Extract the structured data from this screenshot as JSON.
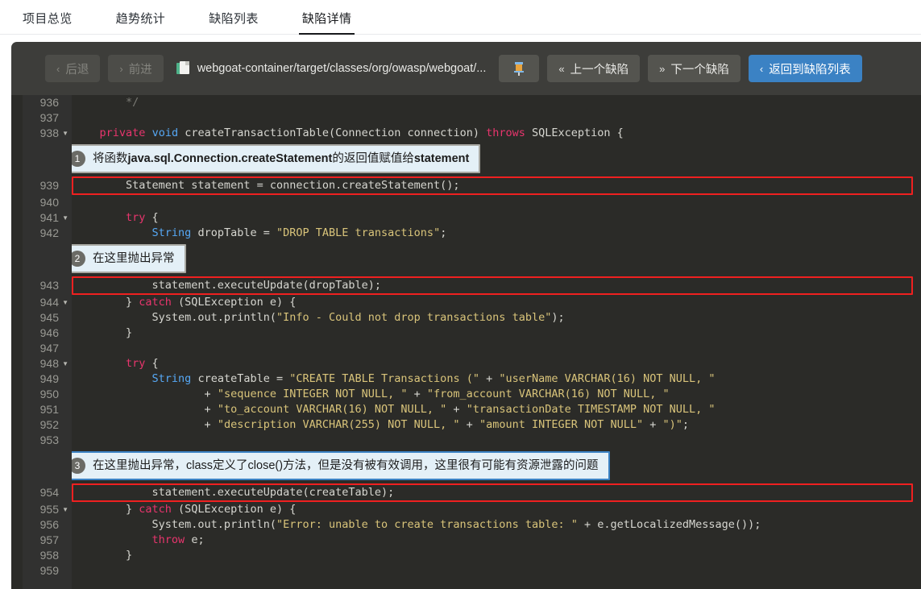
{
  "tabs": [
    {
      "label": "项目总览",
      "active": false
    },
    {
      "label": "趋势统计",
      "active": false
    },
    {
      "label": "缺陷列表",
      "active": false
    },
    {
      "label": "缺陷详情",
      "active": true
    }
  ],
  "toolbar": {
    "back_label": "后退",
    "forward_label": "前进",
    "file_path": "webgoat-container/target/classes/org/owasp/webgoat/...",
    "pin_icon": "pin-icon",
    "prev_defect_label": "上一个缺陷",
    "next_defect_label": "下一个缺陷",
    "back_to_list_label": "返回到缺陷列表",
    "prev_chevron": "«",
    "next_chevron": "»",
    "back_chevron": "‹",
    "forward_chevron": "›",
    "return_chevron": "‹"
  },
  "colors": {
    "accent": "#3b82c4",
    "highlight_border": "#ef2020",
    "panel_bg": "#3d3d3a",
    "code_bg": "#2b2b28",
    "annotation_bg": "#e4f0f7"
  },
  "code": {
    "rows": [
      {
        "kind": "code",
        "num": "936",
        "fold": false,
        "highlight": false,
        "tokens": [
          {
            "t": "        ",
            "c": "pln"
          },
          {
            "t": "*/",
            "c": "cmt"
          }
        ]
      },
      {
        "kind": "code",
        "num": "937",
        "fold": false,
        "highlight": false,
        "tokens": [
          {
            "t": "",
            "c": "pln"
          }
        ]
      },
      {
        "kind": "code",
        "num": "938",
        "fold": true,
        "highlight": false,
        "tokens": [
          {
            "t": "    ",
            "c": "pln"
          },
          {
            "t": "private",
            "c": "kw"
          },
          {
            "t": " ",
            "c": "pln"
          },
          {
            "t": "void",
            "c": "kw2"
          },
          {
            "t": " createTransactionTable(Connection connection) ",
            "c": "pln"
          },
          {
            "t": "throws",
            "c": "kw"
          },
          {
            "t": " SQLException {",
            "c": "pln"
          }
        ]
      },
      {
        "kind": "annotation",
        "index": "1",
        "active": false,
        "text_html": "将函数<b>java.sql.Connection.createStatement</b>的返回值赋值给<b>statement</b>"
      },
      {
        "kind": "code",
        "num": "939",
        "fold": false,
        "highlight": true,
        "tokens": [
          {
            "t": "        Statement statement = connection.createStatement();",
            "c": "pln"
          }
        ]
      },
      {
        "kind": "code",
        "num": "940",
        "fold": false,
        "highlight": false,
        "tokens": [
          {
            "t": "",
            "c": "pln"
          }
        ]
      },
      {
        "kind": "code",
        "num": "941",
        "fold": true,
        "highlight": false,
        "tokens": [
          {
            "t": "        ",
            "c": "pln"
          },
          {
            "t": "try",
            "c": "kw"
          },
          {
            "t": " {",
            "c": "pln"
          }
        ]
      },
      {
        "kind": "code",
        "num": "942",
        "fold": false,
        "highlight": false,
        "tokens": [
          {
            "t": "            ",
            "c": "pln"
          },
          {
            "t": "String",
            "c": "typ"
          },
          {
            "t": " dropTable = ",
            "c": "pln"
          },
          {
            "t": "\"DROP TABLE transactions\"",
            "c": "str"
          },
          {
            "t": ";",
            "c": "pln"
          }
        ]
      },
      {
        "kind": "annotation",
        "index": "2",
        "active": false,
        "text_html": "在这里抛出异常"
      },
      {
        "kind": "code",
        "num": "943",
        "fold": false,
        "highlight": true,
        "tokens": [
          {
            "t": "            statement.executeUpdate(dropTable);",
            "c": "pln"
          }
        ]
      },
      {
        "kind": "code",
        "num": "944",
        "fold": true,
        "highlight": false,
        "tokens": [
          {
            "t": "        } ",
            "c": "pln"
          },
          {
            "t": "catch",
            "c": "kw"
          },
          {
            "t": " (SQLException e) {",
            "c": "pln"
          }
        ]
      },
      {
        "kind": "code",
        "num": "945",
        "fold": false,
        "highlight": false,
        "tokens": [
          {
            "t": "            System.out.println(",
            "c": "pln"
          },
          {
            "t": "\"Info - Could not drop transactions table\"",
            "c": "str"
          },
          {
            "t": ");",
            "c": "pln"
          }
        ]
      },
      {
        "kind": "code",
        "num": "946",
        "fold": false,
        "highlight": false,
        "tokens": [
          {
            "t": "        }",
            "c": "pln"
          }
        ]
      },
      {
        "kind": "code",
        "num": "947",
        "fold": false,
        "highlight": false,
        "tokens": [
          {
            "t": "",
            "c": "pln"
          }
        ]
      },
      {
        "kind": "code",
        "num": "948",
        "fold": true,
        "highlight": false,
        "tokens": [
          {
            "t": "        ",
            "c": "pln"
          },
          {
            "t": "try",
            "c": "kw"
          },
          {
            "t": " {",
            "c": "pln"
          }
        ]
      },
      {
        "kind": "code",
        "num": "949",
        "fold": false,
        "highlight": false,
        "tokens": [
          {
            "t": "            ",
            "c": "pln"
          },
          {
            "t": "String",
            "c": "typ"
          },
          {
            "t": " createTable = ",
            "c": "pln"
          },
          {
            "t": "\"CREATE TABLE Transactions (\"",
            "c": "str"
          },
          {
            "t": " + ",
            "c": "pln"
          },
          {
            "t": "\"userName VARCHAR(16) NOT NULL, \"",
            "c": "str"
          }
        ]
      },
      {
        "kind": "code",
        "num": "950",
        "fold": false,
        "highlight": false,
        "tokens": [
          {
            "t": "                    + ",
            "c": "pln"
          },
          {
            "t": "\"sequence INTEGER NOT NULL, \"",
            "c": "str"
          },
          {
            "t": " + ",
            "c": "pln"
          },
          {
            "t": "\"from_account VARCHAR(16) NOT NULL, \"",
            "c": "str"
          }
        ]
      },
      {
        "kind": "code",
        "num": "951",
        "fold": false,
        "highlight": false,
        "tokens": [
          {
            "t": "                    + ",
            "c": "pln"
          },
          {
            "t": "\"to_account VARCHAR(16) NOT NULL, \"",
            "c": "str"
          },
          {
            "t": " + ",
            "c": "pln"
          },
          {
            "t": "\"transactionDate TIMESTAMP NOT NULL, \"",
            "c": "str"
          }
        ]
      },
      {
        "kind": "code",
        "num": "952",
        "fold": false,
        "highlight": false,
        "tokens": [
          {
            "t": "                    + ",
            "c": "pln"
          },
          {
            "t": "\"description VARCHAR(255) NOT NULL, \"",
            "c": "str"
          },
          {
            "t": " + ",
            "c": "pln"
          },
          {
            "t": "\"amount INTEGER NOT NULL\"",
            "c": "str"
          },
          {
            "t": " + ",
            "c": "pln"
          },
          {
            "t": "\")\"",
            "c": "str"
          },
          {
            "t": ";",
            "c": "pln"
          }
        ]
      },
      {
        "kind": "code",
        "num": "953",
        "fold": false,
        "highlight": false,
        "tokens": [
          {
            "t": "",
            "c": "pln"
          }
        ]
      },
      {
        "kind": "annotation",
        "index": "3",
        "active": true,
        "text_html": "在这里抛出异常，class定义了close()方法，但是没有被有效调用，这里很有可能有资源泄露的问题"
      },
      {
        "kind": "code",
        "num": "954",
        "fold": false,
        "highlight": true,
        "tokens": [
          {
            "t": "            statement.executeUpdate(createTable);",
            "c": "pln"
          }
        ]
      },
      {
        "kind": "code",
        "num": "955",
        "fold": true,
        "highlight": false,
        "tokens": [
          {
            "t": "        } ",
            "c": "pln"
          },
          {
            "t": "catch",
            "c": "kw"
          },
          {
            "t": " (SQLException e) {",
            "c": "pln"
          }
        ]
      },
      {
        "kind": "code",
        "num": "956",
        "fold": false,
        "highlight": false,
        "tokens": [
          {
            "t": "            System.out.println(",
            "c": "pln"
          },
          {
            "t": "\"Error: unable to create transactions table: \"",
            "c": "str"
          },
          {
            "t": " + e.getLocalizedMessage());",
            "c": "pln"
          }
        ]
      },
      {
        "kind": "code",
        "num": "957",
        "fold": false,
        "highlight": false,
        "tokens": [
          {
            "t": "            ",
            "c": "pln"
          },
          {
            "t": "throw",
            "c": "kw"
          },
          {
            "t": " e;",
            "c": "pln"
          }
        ]
      },
      {
        "kind": "code",
        "num": "958",
        "fold": false,
        "highlight": false,
        "tokens": [
          {
            "t": "        }",
            "c": "pln"
          }
        ]
      },
      {
        "kind": "code",
        "num": "959",
        "fold": false,
        "highlight": false,
        "tokens": [
          {
            "t": "",
            "c": "pln"
          }
        ]
      }
    ]
  }
}
